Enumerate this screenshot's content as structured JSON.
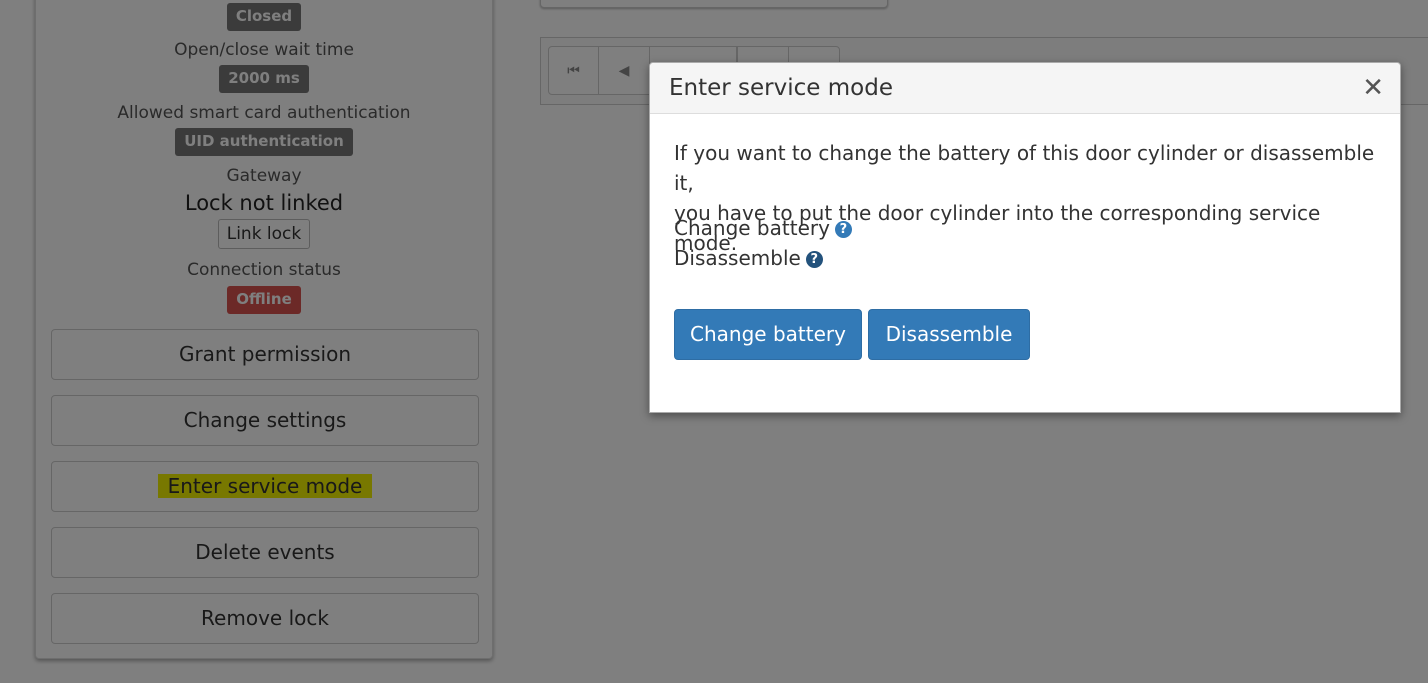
{
  "panel": {
    "lock_state_badge": "Closed",
    "wait_time_label": "Open/close wait time",
    "wait_time_badge": "2000 ms",
    "auth_label": "Allowed smart card authentication",
    "auth_badge": "UID authentication",
    "gateway_label": "Gateway",
    "gateway_value": "Lock not linked",
    "link_lock_button": "Link lock",
    "connection_label": "Connection status",
    "connection_badge": "Offline",
    "buttons": {
      "grant_permission": "Grant permission",
      "change_settings": "Change settings",
      "enter_service_mode": "Enter service mode",
      "delete_events": "Delete events",
      "remove_lock": "Remove lock"
    }
  },
  "pager": {
    "first_icon": "first-page-icon",
    "prev_icon": "previous-page-icon"
  },
  "modal": {
    "title": "Enter service mode",
    "close_icon": "close-icon",
    "description_line1": "If you want to change the battery of this door cylinder or disassemble it,",
    "description_line2": "you have to put the door cylinder into the corresponding service mode.",
    "options": {
      "change_battery": "Change battery",
      "disassemble": "Disassemble"
    },
    "help_icon": "question-circle-icon",
    "buttons": {
      "change_battery": "Change battery",
      "disassemble": "Disassemble"
    }
  },
  "colors": {
    "primary": "#337ab7",
    "badge_gray": "#777777",
    "badge_red": "#d9534f",
    "highlight": "#f0f000",
    "backdrop": "rgba(0,0,0,0.5)"
  }
}
